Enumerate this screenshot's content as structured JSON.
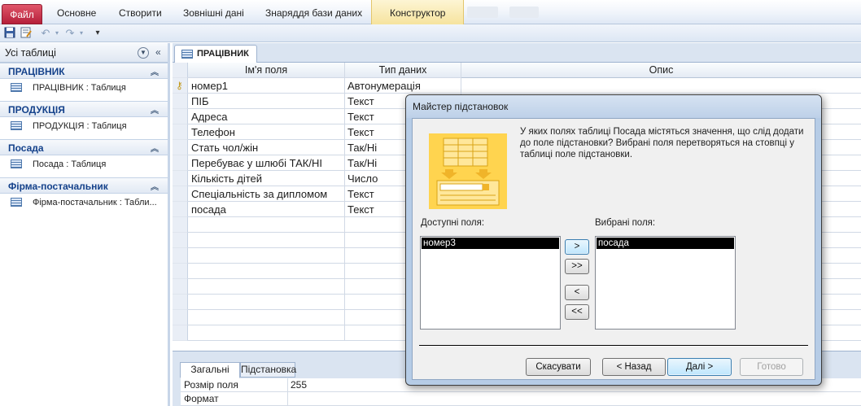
{
  "ribbon": {
    "file_tab": "Файл",
    "tabs": [
      "Основне",
      "Створити",
      "Зовнішні дані",
      "Знаряддя бази даних"
    ],
    "context_tab": "Конструктор"
  },
  "qat": {
    "icons": [
      "save-icon",
      "form-icon",
      "undo-icon",
      "redo-icon",
      "customize-icon"
    ]
  },
  "nav": {
    "header": "Усі таблиці",
    "groups": [
      {
        "title": "ПРАЦІВНИК",
        "item": "ПРАЦІВНИК : Таблиця"
      },
      {
        "title": "ПРОДУКЦІЯ",
        "item": "ПРОДУКЦІЯ : Таблиця"
      },
      {
        "title": "Посада",
        "item": "Посада : Таблиця"
      },
      {
        "title": "Фірма-постачальник",
        "item": "Фірма-постачальник : Табли..."
      }
    ]
  },
  "doc": {
    "tab_title": "ПРАЦІВНИК",
    "columns": [
      "Ім'я поля",
      "Тип даних",
      "Опис"
    ],
    "rows": [
      {
        "name": "номер1",
        "type": "Автонумерація",
        "key": true
      },
      {
        "name": "ПІБ",
        "type": "Текст"
      },
      {
        "name": "Адреса",
        "type": "Текст"
      },
      {
        "name": "Телефон",
        "type": "Текст"
      },
      {
        "name": "Стать чол/жін",
        "type": "Так/Ні"
      },
      {
        "name": "Перебуває у шлюбі ТАК/НІ",
        "type": "Так/Ні"
      },
      {
        "name": "Кількість дітей",
        "type": "Число"
      },
      {
        "name": "Спеціальність за дипломом",
        "type": "Текст"
      },
      {
        "name": "посада",
        "type": "Текст"
      }
    ]
  },
  "props": {
    "tabs": [
      "Загальні",
      "Підстановка"
    ],
    "rows": [
      {
        "key": "Розмір поля",
        "value": "255"
      },
      {
        "key": "Формат",
        "value": ""
      }
    ]
  },
  "wizard": {
    "title": "Майстер підстановок",
    "description": "У яких полях таблиці Посада містяться значення, що слід додати до поле підстановки? Вибрані поля перетворяться на стовпці у таблиці поле підстановки.",
    "available_label": "Доступні поля:",
    "selected_label": "Вибрані поля:",
    "available_fields": [
      "номер3"
    ],
    "selected_fields": [
      "посада"
    ],
    "move_buttons": [
      ">",
      ">>",
      "<",
      "<<"
    ],
    "buttons": {
      "cancel": "Скасувати",
      "back": "< Назад",
      "next": "Далі >",
      "finish": "Готово"
    }
  }
}
